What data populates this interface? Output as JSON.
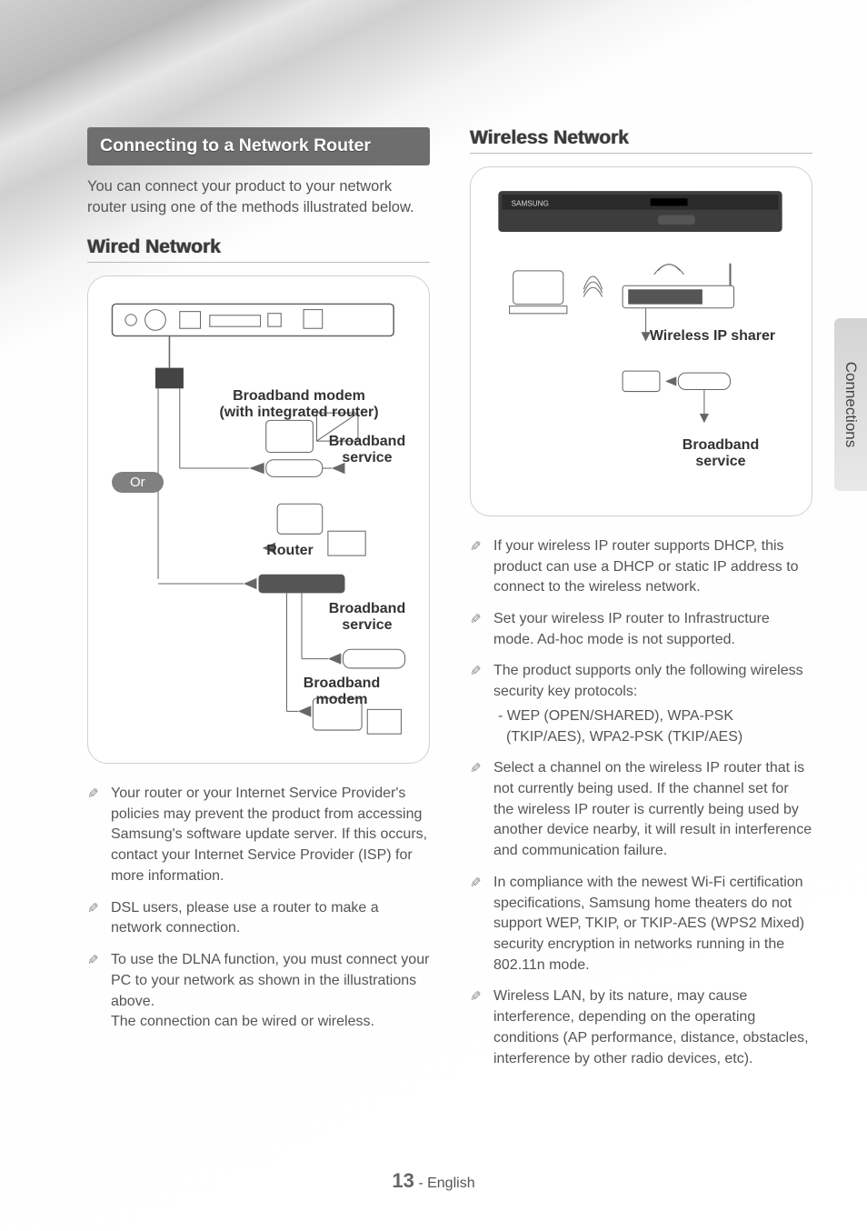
{
  "side_tab": "Connections",
  "page_number": "13",
  "page_lang": "English",
  "left": {
    "section_title": "Connecting to a Network Router",
    "intro": "You can connect your product to your network router using one of the methods illustrated below.",
    "wired_heading": "Wired Network",
    "diagram": {
      "modem_router_label": "Broadband modem\n(with integrated router)",
      "broadband_service_1": "Broadband service",
      "or_label": "Or",
      "router_label": "Router",
      "broadband_service_2": "Broadband service",
      "broadband_modem_label": "Broadband modem"
    },
    "notes": [
      "Your router or your Internet Service Provider's policies may prevent the product from accessing Samsung's software update server. If this occurs, contact your Internet Service Provider (ISP) for more information.",
      "DSL users, please use a router to make a network connection.",
      "To use the DLNA function, you must connect your PC to your network as shown in the illustrations above.\nThe connection can be wired or wireless."
    ]
  },
  "right": {
    "wireless_heading": "Wireless Network",
    "diagram": {
      "wireless_ip_sharer": "Wireless IP sharer",
      "broadband_service": "Broadband service"
    },
    "notes": [
      "If your wireless IP router supports DHCP, this product can use a DHCP or static IP address to connect to the wireless network.",
      "Set your wireless IP router to Infrastructure mode. Ad-hoc mode is not supported.",
      "The product supports only the following wireless security key protocols:",
      "Select a channel on the wireless IP router that is not currently being used. If the channel set for the wireless IP router is currently being used by another device nearby, it will result in interference and communication failure.",
      "In compliance with the newest Wi-Fi certification specifications, Samsung home theaters do not support WEP, TKIP, or TKIP-AES (WPS2 Mixed) security encryption in networks running in the 802.11n mode.",
      "Wireless LAN, by its nature, may cause interference, depending on the operating conditions (AP performance, distance, obstacles, interference by other radio devices, etc)."
    ],
    "note3_sub": "- WEP (OPEN/SHARED), WPA-PSK (TKIP/AES), WPA2-PSK (TKIP/AES)"
  }
}
